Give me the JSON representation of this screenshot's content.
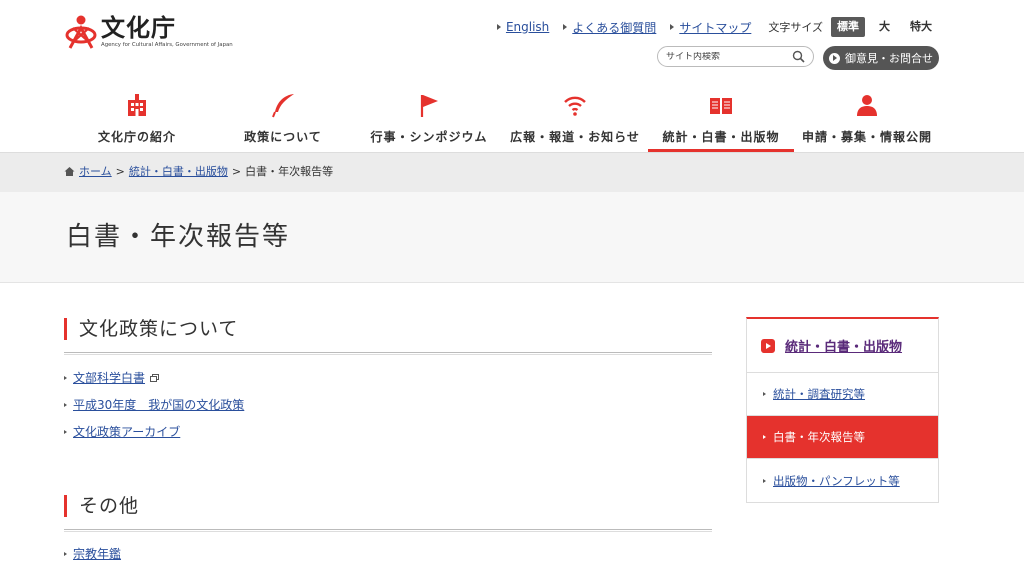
{
  "logo": {
    "title": "文化庁",
    "subtitle": "Agency for Cultural Affairs, Government of Japan"
  },
  "utility_links": [
    {
      "label": "English"
    },
    {
      "label": "よくある御質問"
    },
    {
      "label": "サイトマップ"
    }
  ],
  "font_size": {
    "label": "文字サイズ",
    "options": [
      "標準",
      "大",
      "特大"
    ],
    "selected": "標準"
  },
  "search": {
    "placeholder": "サイト内検索"
  },
  "contact_button": {
    "label": "御意見・お問合せ"
  },
  "global_nav": [
    {
      "label": "文化庁の紹介",
      "icon": "building-icon"
    },
    {
      "label": "政策について",
      "icon": "quill-icon"
    },
    {
      "label": "行事・シンポジウム",
      "icon": "flag-icon"
    },
    {
      "label": "広報・報道・お知らせ",
      "icon": "signal-icon"
    },
    {
      "label": "統計・白書・出版物",
      "icon": "book-icon",
      "active": true
    },
    {
      "label": "申請・募集・情報公開",
      "icon": "person-icon"
    }
  ],
  "breadcrumb": {
    "home": "ホーム",
    "parent": "統計・白書・出版物",
    "current": "白書・年次報告等",
    "separator": ">"
  },
  "page_title": "白書・年次報告等",
  "sections": [
    {
      "heading": "文化政策について",
      "items": [
        {
          "label": "文部科学白書",
          "external": true
        },
        {
          "label": "平成30年度　我が国の文化政策",
          "external": false
        },
        {
          "label": "文化政策アーカイブ",
          "external": false
        }
      ]
    },
    {
      "heading": "その他",
      "items": [
        {
          "label": "宗教年鑑",
          "external": false
        }
      ]
    }
  ],
  "sidebar": {
    "heading": "統計・白書・出版物",
    "items": [
      {
        "label": "統計・調査研究等",
        "active": false
      },
      {
        "label": "白書・年次報告等",
        "active": true
      },
      {
        "label": "出版物・パンフレット等",
        "active": false
      }
    ]
  },
  "colors": {
    "accent": "#e5322d",
    "link": "#2a4f9c",
    "dark_button": "#555555"
  }
}
